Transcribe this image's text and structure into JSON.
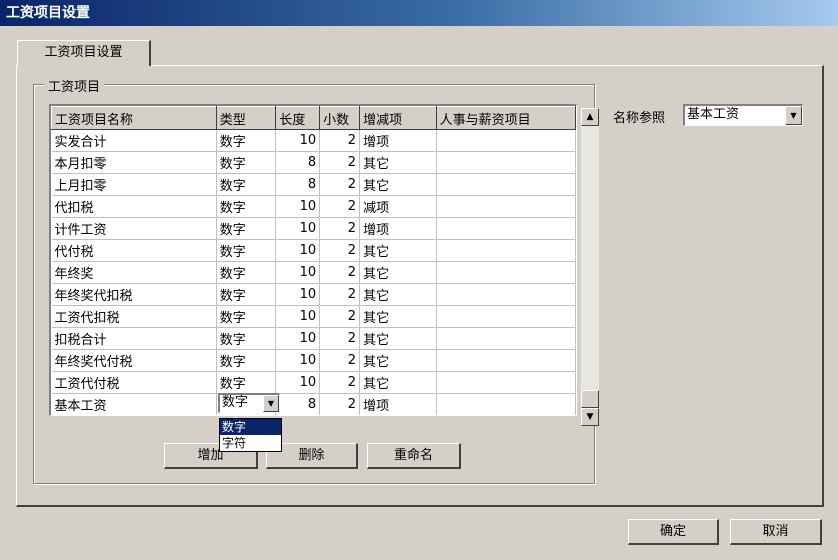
{
  "window": {
    "title": "工资项目设置"
  },
  "tabs": [
    {
      "label": "工资项目设置"
    }
  ],
  "group": {
    "label": "工资项目"
  },
  "table": {
    "columns": [
      "工资项目名称",
      "类型",
      "长度",
      "小数",
      "增减项",
      "人事与薪资项目"
    ],
    "rows": [
      [
        "实发合计",
        "数字",
        "10",
        "2",
        "增项",
        ""
      ],
      [
        "本月扣零",
        "数字",
        "8",
        "2",
        "其它",
        ""
      ],
      [
        "上月扣零",
        "数字",
        "8",
        "2",
        "其它",
        ""
      ],
      [
        "代扣税",
        "数字",
        "10",
        "2",
        "减项",
        ""
      ],
      [
        "计件工资",
        "数字",
        "10",
        "2",
        "增项",
        ""
      ],
      [
        "代付税",
        "数字",
        "10",
        "2",
        "其它",
        ""
      ],
      [
        "年终奖",
        "数字",
        "10",
        "2",
        "其它",
        ""
      ],
      [
        "年终奖代扣税",
        "数字",
        "10",
        "2",
        "其它",
        ""
      ],
      [
        "工资代扣税",
        "数字",
        "10",
        "2",
        "其它",
        ""
      ],
      [
        "扣税合计",
        "数字",
        "10",
        "2",
        "其它",
        ""
      ],
      [
        "年终奖代付税",
        "数字",
        "10",
        "2",
        "其它",
        ""
      ],
      [
        "工资代付税",
        "数字",
        "10",
        "2",
        "其它",
        ""
      ],
      [
        "基本工资",
        "",
        "8",
        "2",
        "增项",
        ""
      ]
    ],
    "editing": {
      "type_value": "数字",
      "options": [
        "数字",
        "字符"
      ],
      "selected": "数字"
    }
  },
  "reference": {
    "label": "名称参照",
    "value": "基本工资"
  },
  "buttons": {
    "add": "增加",
    "delete": "删除",
    "rename": "重命名",
    "ok": "确定",
    "cancel": "取消"
  },
  "icons": {
    "scroll_up": "scroll-up-arrow-icon",
    "scroll_down": "scroll-down-arrow-icon",
    "dropdown": "chevron-down-icon"
  }
}
